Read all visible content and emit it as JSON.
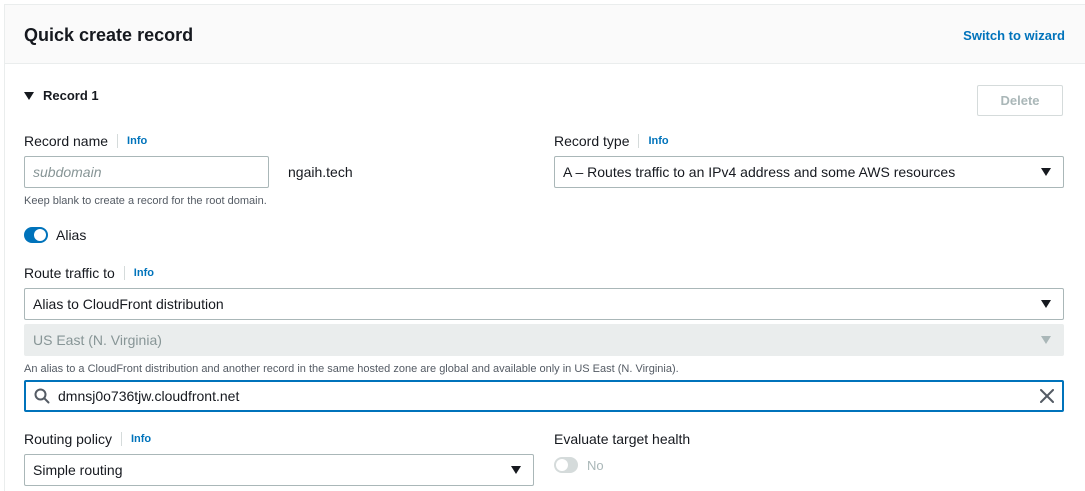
{
  "panel": {
    "title": "Quick create record",
    "switch_link": "Switch to wizard"
  },
  "record": {
    "label": "Record 1",
    "delete_label": "Delete"
  },
  "record_name": {
    "label": "Record name",
    "info": "Info",
    "placeholder": "subdomain",
    "value": "",
    "domain_suffix": "ngaih.tech",
    "hint": "Keep blank to create a record for the root domain."
  },
  "record_type": {
    "label": "Record type",
    "info": "Info",
    "selected": "A – Routes traffic to an IPv4 address and some AWS resources"
  },
  "alias": {
    "label": "Alias",
    "enabled": true
  },
  "route_traffic": {
    "label": "Route traffic to",
    "info": "Info",
    "endpoint_selected": "Alias to CloudFront distribution",
    "region_selected": "US East (N. Virginia)",
    "hint": "An alias to a CloudFront distribution and another record in the same hosted zone are global and available only in US East (N. Virginia).",
    "distribution_value": "dmnsj0o736tjw.cloudfront.net"
  },
  "routing_policy": {
    "label": "Routing policy",
    "info": "Info",
    "selected": "Simple routing"
  },
  "evaluate_health": {
    "label": "Evaluate target health",
    "state_label": "No",
    "enabled": false
  },
  "colors": {
    "accent": "#0073bb",
    "text": "#16191f",
    "muted": "#879596"
  },
  "icons": {
    "caret": "caret-down-icon",
    "search": "search-icon",
    "clear": "close-icon"
  }
}
